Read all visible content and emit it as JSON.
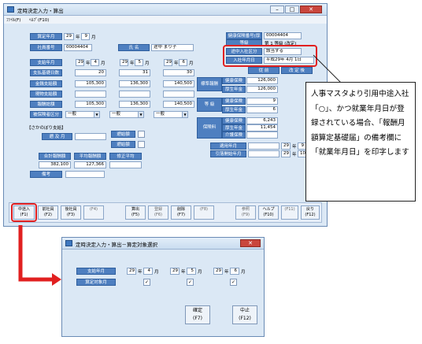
{
  "main_window": {
    "title": "定時決定入力・算出",
    "menu": [
      "ﾌｧｲﾙ(F)",
      "ﾍﾙﾌﾟ(F10)"
    ],
    "labels": {
      "target_month": "算定年月",
      "employee_no": "社員番号",
      "name": "氏 名",
      "pay_month": "支給年月",
      "base_days": "支払基礎日数",
      "cash_pay": "金銭支給額",
      "in_kind_pay": "現物支給額",
      "total_pay": "報酬総額",
      "insurance_category": "被保険者区分",
      "retro_header": "【さかのぼり支給】",
      "month_lbl": "遡 及 月",
      "amount_lbl": "遡給額",
      "total_amount": "合計報酬額",
      "avg_amount": "平均報酬額",
      "revised_avg": "修正平均",
      "remarks": "備考",
      "insurance_no": "健康保険番号(厚生)",
      "grade": "等級",
      "mid_join": "途中入社区分",
      "join_date": "入社年月日",
      "before": "従 前",
      "after": "改 定 後",
      "std_remuneration": "標準報酬",
      "health_ins": "健康保険",
      "pension": "厚生年金",
      "grade_lbl": "等 級",
      "premium": "保険料",
      "nursing": "介護保険",
      "apply_month": "適用年月",
      "deduction_start": "引落開始年月"
    },
    "values": {
      "target_year": "29",
      "target_month": "9",
      "year_unit": "年",
      "month_unit": "月",
      "employee_no": "00004404",
      "name": "途中 まり子",
      "pay": [
        {
          "year": "29",
          "month": "4",
          "days": "20",
          "cash": "105,300",
          "kind": "",
          "total": "105,300"
        },
        {
          "year": "29",
          "month": "5",
          "days": "31",
          "cash": "136,300",
          "kind": "",
          "total": "136,300"
        },
        {
          "year": "29",
          "month": "6",
          "days": "30",
          "cash": "140,500",
          "kind": "",
          "total": "140,500"
        }
      ],
      "insurance_category": [
        "一般",
        "一般",
        "一般"
      ],
      "total_amount": "382,100",
      "avg_amount": "127,366",
      "insurance_no": "00004404",
      "grade_info": "第 1 等級 (改定)",
      "mid_join": "該当する",
      "join_date": "平成29年 4月 1日",
      "std_health": "126,000",
      "std_pension": "126,000",
      "grade_health": "9",
      "grade_pension": "6",
      "premium_health": "6,243",
      "premium_pension": "11,454",
      "apply_year": "29",
      "apply_month": "9",
      "deduct_year": "29",
      "deduct_month": "10"
    },
    "fkeys": [
      {
        "label": "中途入",
        "key": "F1"
      },
      {
        "label": "前社員",
        "key": "F2"
      },
      {
        "label": "後社員",
        "key": "F3"
      },
      {
        "label": "",
        "key": "F4"
      },
      {
        "label": "算出",
        "key": "F5"
      },
      {
        "label": "登録",
        "key": "F6"
      },
      {
        "label": "削除",
        "key": "F7"
      },
      {
        "label": "",
        "key": "F8"
      },
      {
        "label": "参照",
        "key": "F9"
      },
      {
        "label": "ヘルプ",
        "key": "F10"
      },
      {
        "label": "",
        "key": "F11"
      },
      {
        "label": "戻り",
        "key": "F12"
      }
    ]
  },
  "callout": {
    "text": "人事マスタより引用中途入社「○」、かつ就業年月日が登録されている場合、「報酬月額算定基礎届」の備考欄に「就業年月日」を印字します"
  },
  "dialog": {
    "title": "定時決定入力・算出－算定対象選択",
    "pay_month_label": "支給年月",
    "target_month_label": "算定対象月",
    "months": [
      {
        "year": "29",
        "month": "4",
        "checked": true
      },
      {
        "year": "29",
        "month": "5",
        "checked": true
      },
      {
        "year": "29",
        "month": "6",
        "checked": true
      }
    ],
    "ok_label": "確定",
    "ok_key": "F7",
    "cancel_label": "中止",
    "cancel_key": "F12",
    "check_glyph": "✓"
  },
  "accent": {
    "label_blue": "#4e7fc0",
    "highlight_red": "#e12020"
  }
}
